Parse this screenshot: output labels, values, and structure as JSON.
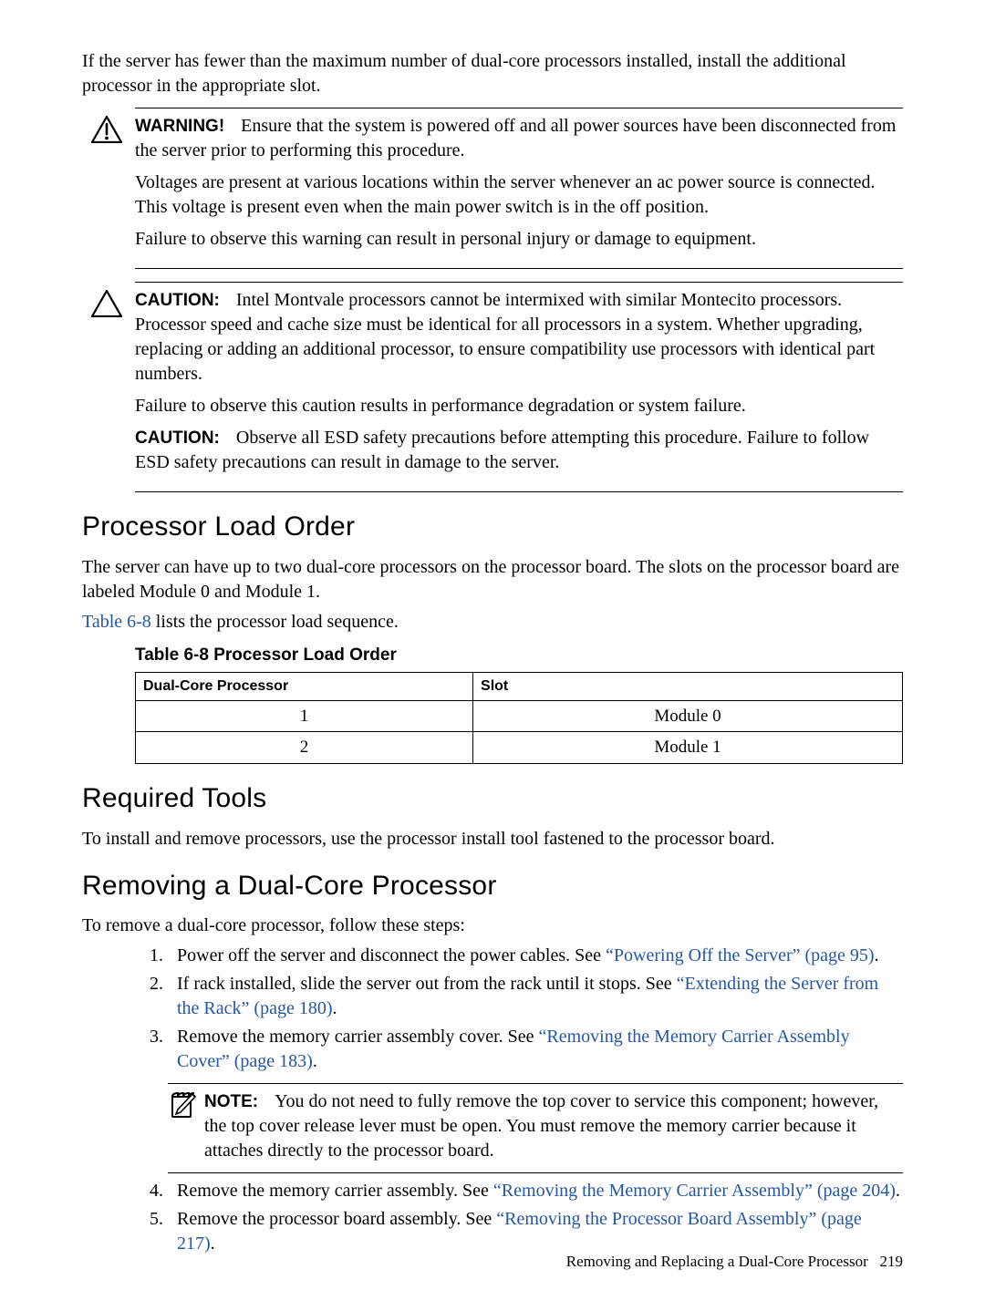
{
  "intro": {
    "p1": "If the server has fewer than the maximum number of dual-core processors installed, install the additional processor in the appropriate slot."
  },
  "warning": {
    "label": "WARNING!",
    "p1": "Ensure that the system is powered off and all power sources have been disconnected from the server prior to performing this procedure.",
    "p2": "Voltages are present at various locations within the server whenever an ac power source is connected. This voltage is present even when the main power switch is in the off position.",
    "p3": "Failure to observe this warning can result in personal injury or damage to equipment."
  },
  "caution1": {
    "label": "CAUTION:",
    "p1": "Intel Montvale processors cannot be intermixed with similar Montecito processors. Processor speed and cache size must be identical for all processors in a system. Whether upgrading, replacing or adding an additional processor, to ensure compatibility use processors with identical part numbers.",
    "p2": "Failure to observe this caution results in performance degradation or system failure."
  },
  "caution2": {
    "label": "CAUTION:",
    "p1": "Observe all ESD safety precautions before attempting this procedure. Failure to follow ESD safety precautions can result in damage to the server."
  },
  "sections": {
    "load_order_title": "Processor Load Order",
    "load_order_p1": "The server can have up to two dual-core processors on the processor board. The slots on the processor board are labeled Module 0 and Module 1.",
    "load_order_p2a": "Table 6-8",
    "load_order_p2b": " lists the processor load sequence.",
    "table_title": "Table  6-8  Processor Load Order",
    "required_tools_title": "Required Tools",
    "required_tools_p1": "To install and remove processors, use the processor install tool fastened to the processor board.",
    "removing_title": "Removing a Dual-Core Processor",
    "removing_p1": "To remove a dual-core processor, follow these steps:"
  },
  "chart_data": {
    "type": "table",
    "title": "Table 6-8 Processor Load Order",
    "columns": [
      "Dual-Core Processor",
      "Slot"
    ],
    "rows": [
      {
        "processor": "1",
        "slot": "Module 0"
      },
      {
        "processor": "2",
        "slot": "Module 1"
      }
    ]
  },
  "steps": {
    "s1a": "Power off the server and disconnect the power cables. See ",
    "s1link": "“Powering Off the Server” (page 95)",
    "s1b": ".",
    "s2a": "If rack installed, slide the server out from the rack until it stops. See ",
    "s2link": "“Extending the Server from the Rack” (page 180)",
    "s2b": ".",
    "s3a": "Remove the memory carrier assembly cover. See ",
    "s3link": "“Removing the Memory Carrier Assembly Cover” (page 183)",
    "s3b": ".",
    "s4a": "Remove the memory carrier assembly. See ",
    "s4link": "“Removing the Memory Carrier Assembly” (page 204)",
    "s4b": ".",
    "s5a": "Remove the processor board assembly. See ",
    "s5link": "“Removing the Processor Board Assembly” (page 217)",
    "s5b": "."
  },
  "note": {
    "label": "NOTE:",
    "p1": "You do not need to fully remove the top cover to service this component; however, the top cover release lever must be open. You must remove the memory carrier because it attaches directly to the processor board."
  },
  "footer": {
    "text": "Removing and Replacing a Dual-Core Processor",
    "page": "219"
  }
}
